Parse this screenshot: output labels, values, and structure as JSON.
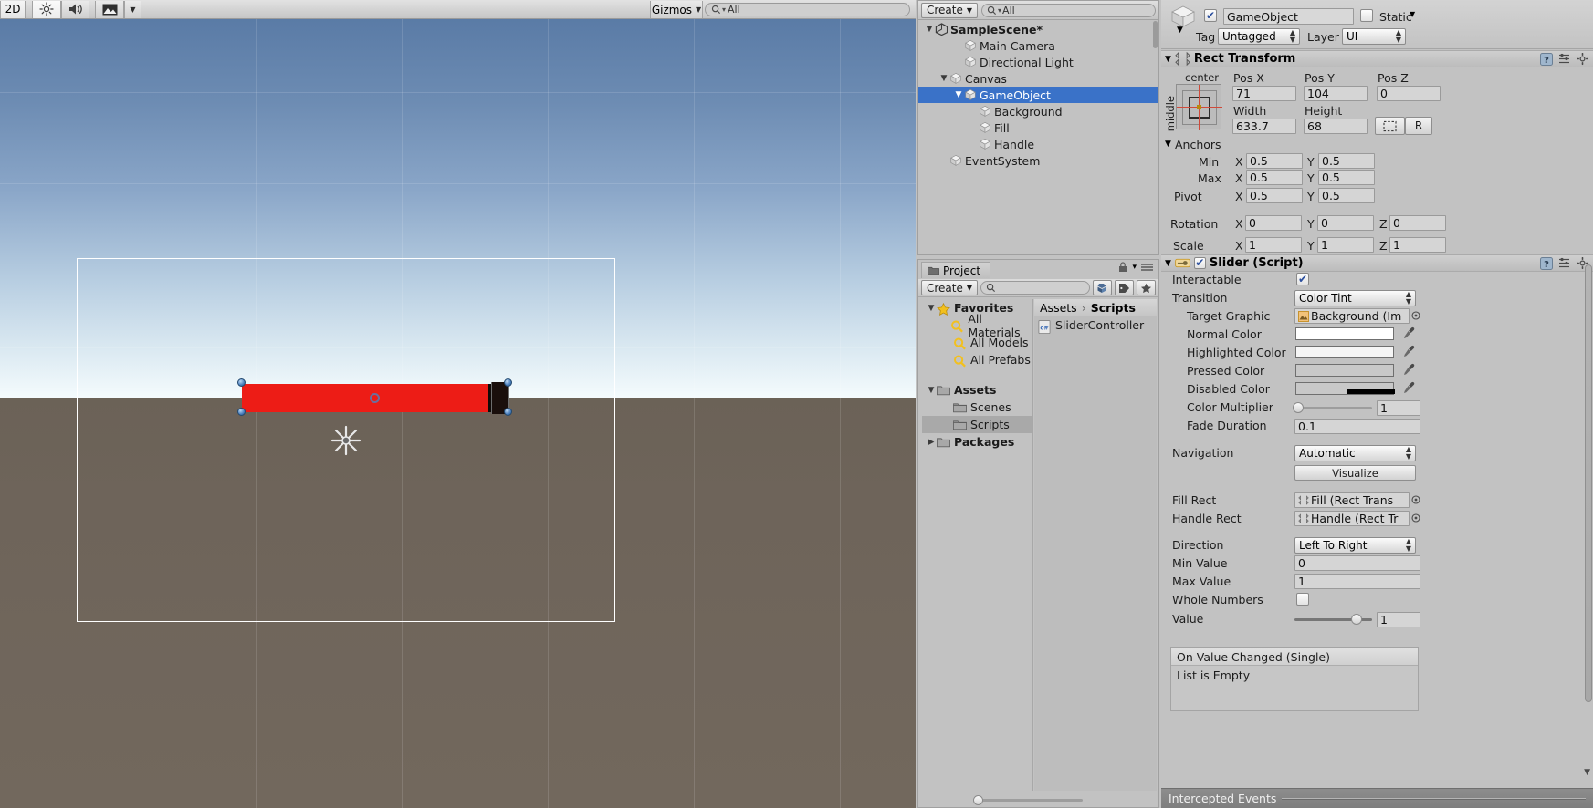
{
  "scene_view": {
    "toolbar": {
      "mode_2d": "2D",
      "lighting_icon": "sun-icon",
      "audio_icon": "speaker-icon",
      "fx_icon": "image-icon",
      "fx_dropdown_icon": "chevron-down-icon",
      "gizmos_label": "Gizmos",
      "gizmos_arrow_icon": "chevron-down-icon",
      "search_icon": "search-icon",
      "search_value": "All",
      "search_placeholder": "All"
    },
    "objects": {
      "canvas_outline": "canvas-rect",
      "slider_fill_color": "#ed1c16",
      "slider_bg_color": "#100a08",
      "handle_color": "#1a0f0c",
      "move_tool_icon": "move-gizmo-icon"
    }
  },
  "hierarchy": {
    "toolbar": {
      "create_label": "Create",
      "create_arrow_icon": "chevron-down-icon",
      "search_icon": "search-icon",
      "search_value": "All"
    },
    "menu_icon": "hamburger-menu-icon",
    "items": [
      {
        "label": "SampleScene*",
        "depth": 0,
        "foldout": "open",
        "icon": "unity-scene-icon",
        "bold": true,
        "selected": false
      },
      {
        "label": "Main Camera",
        "depth": 2,
        "foldout": "none",
        "icon": "gameobject-cube-icon",
        "bold": false,
        "selected": false
      },
      {
        "label": "Directional Light",
        "depth": 2,
        "foldout": "none",
        "icon": "gameobject-cube-icon",
        "bold": false,
        "selected": false
      },
      {
        "label": "Canvas",
        "depth": 1,
        "foldout": "open",
        "icon": "gameobject-cube-icon",
        "bold": false,
        "selected": false
      },
      {
        "label": "GameObject",
        "depth": 2,
        "foldout": "open",
        "icon": "gameobject-cube-icon",
        "bold": false,
        "selected": true
      },
      {
        "label": "Background",
        "depth": 3,
        "foldout": "none",
        "icon": "gameobject-cube-icon",
        "bold": false,
        "selected": false
      },
      {
        "label": "Fill",
        "depth": 3,
        "foldout": "none",
        "icon": "gameobject-cube-icon",
        "bold": false,
        "selected": false
      },
      {
        "label": "Handle",
        "depth": 3,
        "foldout": "none",
        "icon": "gameobject-cube-icon",
        "bold": false,
        "selected": false
      },
      {
        "label": "EventSystem",
        "depth": 1,
        "foldout": "none",
        "icon": "gameobject-cube-icon",
        "bold": false,
        "selected": false
      }
    ]
  },
  "project": {
    "tab_label": "Project",
    "tab_icon": "folder-icon",
    "lock_icon": "lock-icon",
    "menu_icon": "hamburger-menu-icon",
    "toolbar": {
      "create_label": "Create",
      "create_arrow_icon": "chevron-down-icon",
      "search_icon": "search-icon",
      "search_value": "",
      "icon_buttons": [
        "object-filter-icon",
        "label-filter-icon",
        "favorite-star-icon"
      ]
    },
    "tree": [
      {
        "label": "Favorites",
        "depth": 0,
        "foldout": "open",
        "icon": "favorite-star-icon",
        "bold": true,
        "selected": false
      },
      {
        "label": "All Materials",
        "depth": 1,
        "foldout": "none",
        "icon": "search-saved-icon",
        "bold": false,
        "selected": false
      },
      {
        "label": "All Models",
        "depth": 1,
        "foldout": "none",
        "icon": "search-saved-icon",
        "bold": false,
        "selected": false
      },
      {
        "label": "All Prefabs",
        "depth": 1,
        "foldout": "none",
        "icon": "search-saved-icon",
        "bold": false,
        "selected": false
      },
      {
        "label": "Assets",
        "depth": 0,
        "foldout": "open",
        "icon": "folder-icon",
        "bold": true,
        "selected": false
      },
      {
        "label": "Scenes",
        "depth": 1,
        "foldout": "none",
        "icon": "folder-icon",
        "bold": false,
        "selected": false
      },
      {
        "label": "Scripts",
        "depth": 1,
        "foldout": "none",
        "icon": "folder-icon",
        "bold": false,
        "selected": true
      },
      {
        "label": "Packages",
        "depth": 0,
        "foldout": "closed",
        "icon": "folder-icon",
        "bold": true,
        "selected": false
      }
    ],
    "breadcrumb": [
      "Assets",
      "Scripts"
    ],
    "breadcrumb_separator": "›",
    "assets": [
      {
        "label": "SliderController",
        "icon": "csharp-script-icon"
      }
    ],
    "zoom_slider_value": 0
  },
  "inspector": {
    "header": {
      "object_icon": "gameobject-cube-icon",
      "enabled": true,
      "name": "GameObject",
      "static_label": "Static",
      "static_checked": false,
      "static_arrow_icon": "chevron-down-icon",
      "tag_label": "Tag",
      "tag_value": "Untagged",
      "layer_label": "Layer",
      "layer_value": "UI"
    },
    "rect_transform": {
      "title": "Rect Transform",
      "foldout": "open",
      "icon": "rect-transform-icon",
      "help_icon": "help-icon",
      "preset_icon": "preset-icon",
      "settings_icon": "gear-icon",
      "anchor_preset_h": "center",
      "anchor_preset_v": "middle",
      "pos_x_label": "Pos X",
      "pos_x": "71",
      "pos_y_label": "Pos Y",
      "pos_y": "104",
      "pos_z_label": "Pos Z",
      "pos_z": "0",
      "width_label": "Width",
      "width": "633.7",
      "height_label": "Height",
      "height": "68",
      "blueprint_icon": "blueprint-icon",
      "raw_label": "R",
      "anchors_label": "Anchors",
      "min_label": "Min",
      "min_x": "0.5",
      "min_y": "0.5",
      "max_label": "Max",
      "max_x": "0.5",
      "max_y": "0.5",
      "pivot_label": "Pivot",
      "pivot_x": "0.5",
      "pivot_y": "0.5",
      "rotation_label": "Rotation",
      "rot_x": "0",
      "rot_y": "0",
      "rot_z": "0",
      "scale_label": "Scale",
      "scale_x": "1",
      "scale_y": "1",
      "scale_z": "1",
      "axis_x": "X",
      "axis_y": "Y",
      "axis_z": "Z"
    },
    "slider_script": {
      "title": "Slider (Script)",
      "foldout": "open",
      "component_icon": "slider-component-icon",
      "enabled": true,
      "help_icon": "help-icon",
      "preset_icon": "preset-icon",
      "settings_icon": "gear-icon",
      "interactable_label": "Interactable",
      "interactable_checked": true,
      "transition_label": "Transition",
      "transition_value": "Color Tint",
      "target_graphic_label": "Target Graphic",
      "target_graphic_value": "Background (Im",
      "target_graphic_icon": "image-component-icon",
      "object_picker_icon": "object-picker-icon",
      "normal_color_label": "Normal Color",
      "normal_color": "#ffffff",
      "highlighted_color_label": "Highlighted Color",
      "highlighted_color": "#f5f5f5",
      "pressed_color_label": "Pressed Color",
      "pressed_color": "#c8c8c8",
      "disabled_color_label": "Disabled Color",
      "disabled_color": "#c8c8c8",
      "eyedropper_icon": "eyedropper-icon",
      "color_multiplier_label": "Color Multiplier",
      "color_multiplier": "1",
      "color_multiplier_pos": 0,
      "fade_duration_label": "Fade Duration",
      "fade_duration": "0.1",
      "navigation_label": "Navigation",
      "navigation_value": "Automatic",
      "visualize_label": "Visualize",
      "fill_rect_label": "Fill Rect",
      "fill_rect_value": "Fill (Rect Trans",
      "handle_rect_label": "Handle Rect",
      "handle_rect_value": "Handle (Rect Tr",
      "rect_transform_icon": "rect-transform-icon",
      "direction_label": "Direction",
      "direction_value": "Left To Right",
      "min_value_label": "Min Value",
      "min_value": "0",
      "max_value_label": "Max Value",
      "max_value": "1",
      "whole_numbers_label": "Whole Numbers",
      "whole_numbers_checked": false,
      "value_label": "Value",
      "value": "1",
      "value_slider_pos": 100,
      "on_value_changed_label": "On Value Changed (Single)",
      "list_empty_label": "List is Empty"
    },
    "intercepted_events": {
      "label": "Intercepted Events"
    }
  }
}
